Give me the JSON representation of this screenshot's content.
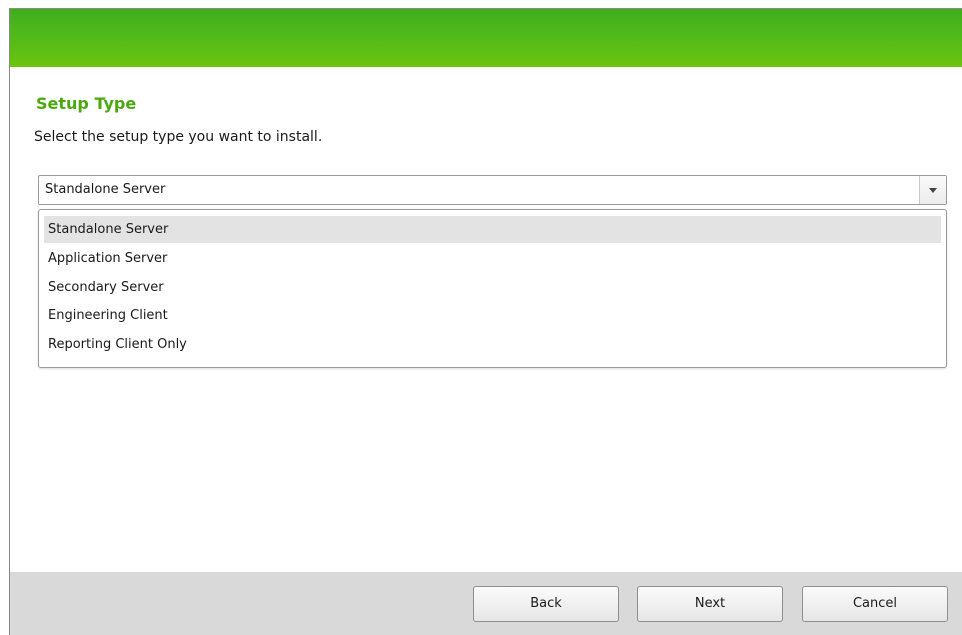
{
  "page": {
    "title": "Setup Type",
    "subtitle": "Select the setup type you want to install."
  },
  "setup_type": {
    "selected_value": "Standalone Server",
    "options": [
      {
        "label": "Standalone Server",
        "selected": true
      },
      {
        "label": "Application Server",
        "selected": false
      },
      {
        "label": "Secondary Server",
        "selected": false
      },
      {
        "label": "Engineering Client",
        "selected": false
      },
      {
        "label": "Reporting Client Only",
        "selected": false
      }
    ]
  },
  "buttons": {
    "back": "Back",
    "next": "Next",
    "cancel": "Cancel"
  },
  "colors": {
    "banner": "#4fb81b",
    "title": "#4aa90f",
    "footer": "#d9d9d9",
    "selected_option": "#e3e3e3"
  },
  "icons": {
    "combo_arrow": "chevron-down-icon"
  }
}
